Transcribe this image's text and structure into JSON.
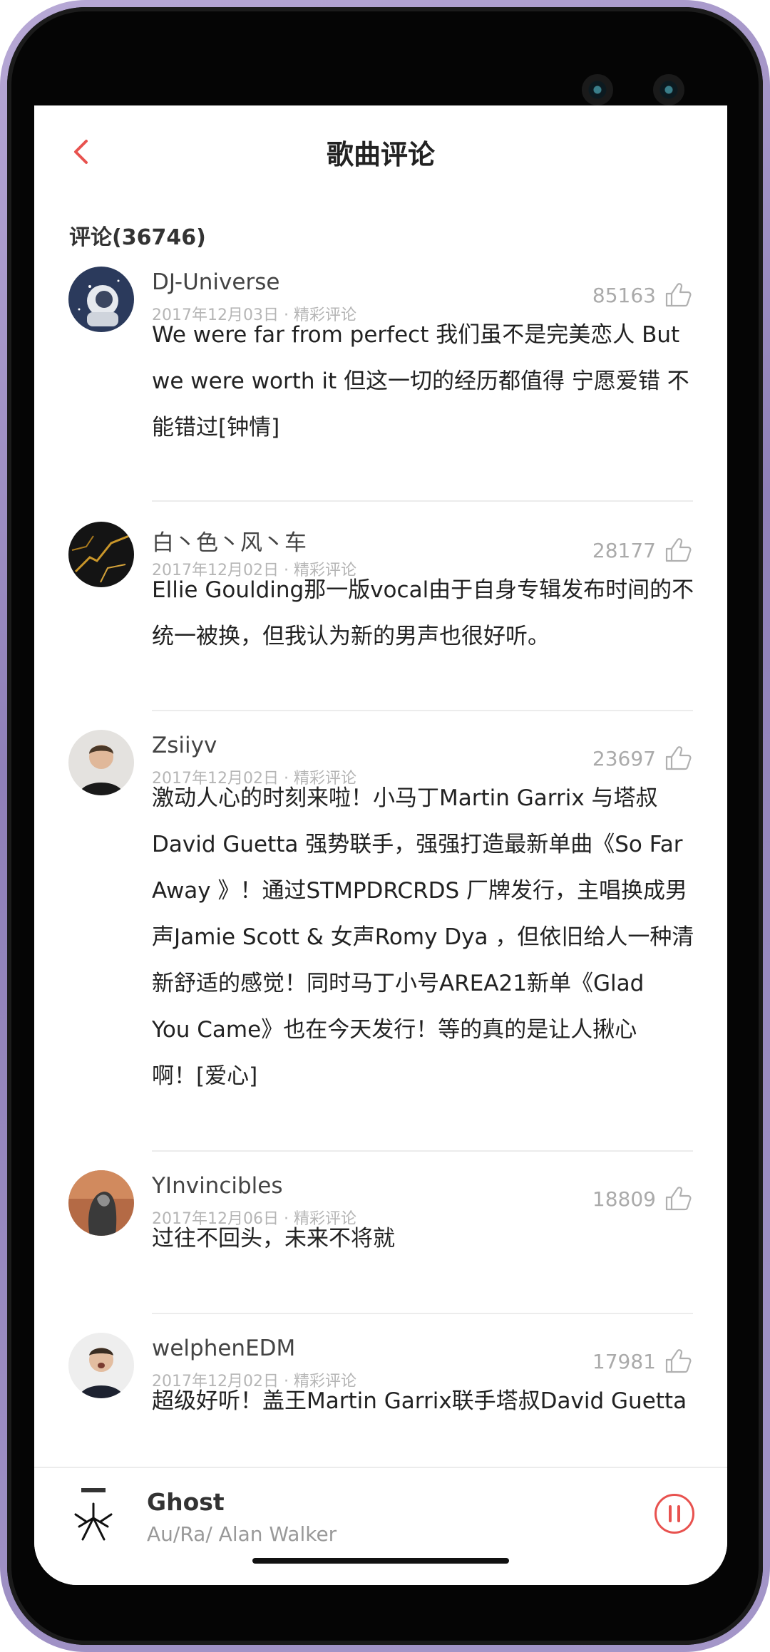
{
  "header": {
    "title": "歌曲评论"
  },
  "section": {
    "label": "评论(36746)"
  },
  "comments": [
    {
      "name": "DJ-Universe",
      "meta": "2017年12月03日 · 精彩评论",
      "likes": "85163",
      "lines": [
        "We were far from perfect 我们虽不是完美恋人 But",
        "we were worth it 但这一切的经历都值得 宁愿爱错 不",
        "能错过[钟情]"
      ]
    },
    {
      "name": "白丶色丶风丶车",
      "meta": "2017年12月02日 · 精彩评论",
      "likes": "28177",
      "lines": [
        "Ellie Goulding那一版vocal由于自身专辑发布时间的不",
        "统一被换，但我认为新的男声也很好听。"
      ]
    },
    {
      "name": "Zsiiyv",
      "meta": "2017年12月02日 · 精彩评论",
      "likes": "23697",
      "lines": [
        "激动人心的时刻来啦！小马丁Martin Garrix 与塔叔",
        "David Guetta 强势联手，强强打造最新单曲《So Far",
        "Away 》！通过STMPDRCRDS 厂牌发行，主唱换成男",
        "声Jamie Scott & 女声Romy Dya ，但依旧给人一种清",
        "新舒适的感觉！同时马丁小号AREA21新单《Glad",
        "You Came》也在今天发行！等的真的是让人揪心",
        "啊！[爱心]"
      ]
    },
    {
      "name": "YInvincibles",
      "meta": "2017年12月06日 · 精彩评论",
      "likes": "18809",
      "lines": [
        "过往不回头，未来不将就"
      ]
    },
    {
      "name": "welphenEDM",
      "meta": "2017年12月02日 · 精彩评论",
      "likes": "17981",
      "lines": [
        "超级好听！盖王Martin Garrix联手塔叔David Guetta"
      ]
    }
  ],
  "player": {
    "song": "Ghost",
    "artist": "Au/Ra/ Alan Walker"
  },
  "colors": {
    "accent": "#e8524f",
    "text": "#222222",
    "meta": "#b5b5b5",
    "divider": "#ececec"
  },
  "icons": {
    "back": "chevron-left-icon",
    "like": "thumbs-up-icon",
    "pause": "pause-icon"
  }
}
